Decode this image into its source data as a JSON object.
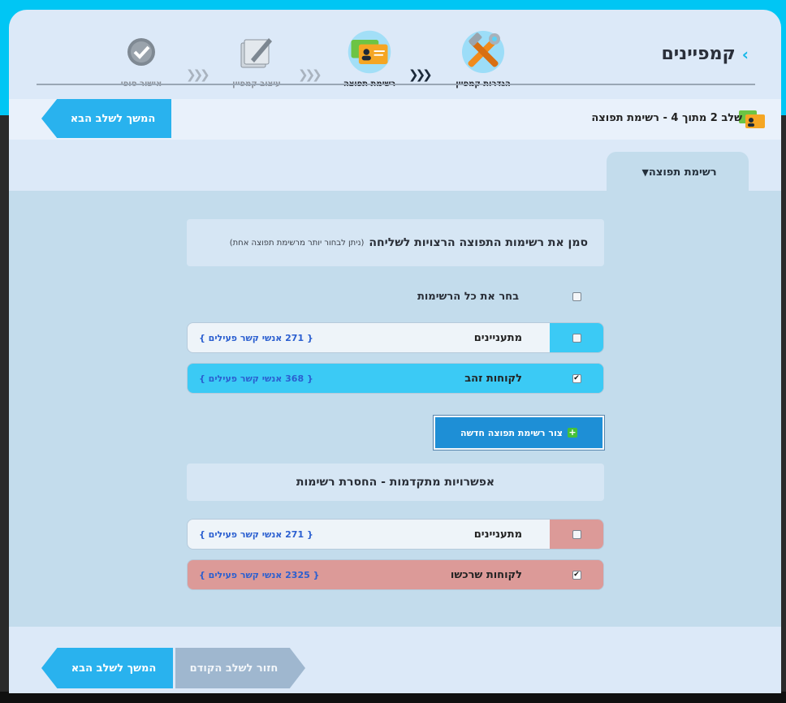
{
  "page": {
    "title": "קמפיינים"
  },
  "steps": [
    {
      "label": "הגדרות קמפיין",
      "icon": "tools-icon",
      "state": "done"
    },
    {
      "label": "רשימת תפוצה",
      "icon": "contact-cards-icon",
      "state": "current"
    },
    {
      "label": "עיצוב קמפיין",
      "icon": "design-pen-icon",
      "state": "inactive"
    },
    {
      "label": "אישור סופי",
      "icon": "check-circle-icon",
      "state": "inactive"
    }
  ],
  "stepbar": {
    "text": "שלב 2 מתוך 4 - רשימת תפוצה",
    "next_label": "המשך לשלב הבא"
  },
  "tab": {
    "label": "רשימת תפוצה"
  },
  "instruction": {
    "title": "סמן את רשימות התפוצה הרצויות לשליחה",
    "note": "(ניתן לבחור יותר מרשימת תפוצה אחת)"
  },
  "select_all": {
    "label": "בחר את כל הרשימות",
    "checked": false
  },
  "lists": [
    {
      "name": "מתעניינים",
      "count": "{ 271 אנשי קשר פעילים }",
      "checked": false
    },
    {
      "name": "לקוחות זהב",
      "count": "{ 368 אנשי קשר פעילים }",
      "checked": true
    }
  ],
  "new_list_button": {
    "label": "צור רשימת תפוצה חדשה"
  },
  "advanced": {
    "title": "אפשרויות מתקדמות - החסרת רשימות"
  },
  "exclude_lists": [
    {
      "name": "מתעניינים",
      "count": "{ 271 אנשי קשר פעילים }",
      "checked": false
    },
    {
      "name": "לקוחות שרכשו",
      "count": "{ 2325 אנשי קשר פעילים }",
      "checked": true
    }
  ],
  "footer": {
    "next_label": "המשך לשלב הבא",
    "prev_label": "חזור לשלב הקודם"
  },
  "colors": {
    "accent": "#29b2ee",
    "exclude": "#dc9a98",
    "link": "#2b5fd0"
  }
}
